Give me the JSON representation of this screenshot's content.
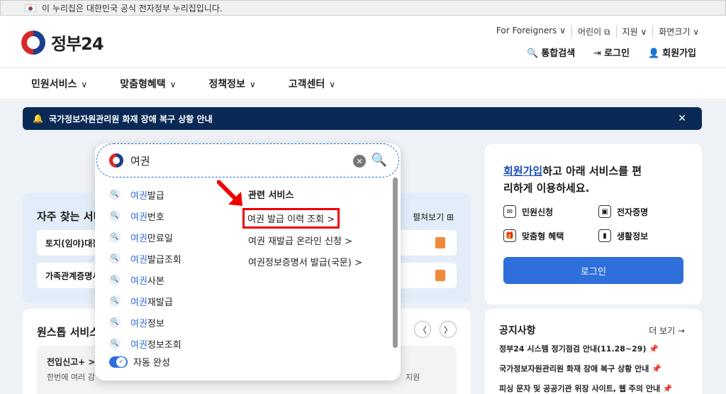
{
  "topbar": {
    "text": "이 누리집은 대한민국 공식 전자정부 누리집입니다."
  },
  "logo": {
    "name": "정부24",
    "plus": "+"
  },
  "util": [
    "For Foreigners ∨",
    "어린이 ⧉",
    "지원 ∨",
    "화면크기 ∨"
  ],
  "actions": [
    {
      "icon": "🔍",
      "label": "통합검색"
    },
    {
      "icon": "⇥",
      "label": "로그인"
    },
    {
      "icon": "👤",
      "label": "회원가입"
    }
  ],
  "nav": [
    "민원서비스",
    "맞춤형혜택",
    "정책정보",
    "고객센터"
  ],
  "notice": {
    "text": "국가정보자원관리원 화재 장애 복구 상황 안내",
    "close": "✕"
  },
  "search": {
    "value": "여권",
    "clear": "✕",
    "suggestions": [
      {
        "hl": "여권",
        "rest": "발급"
      },
      {
        "hl": "여권",
        "rest": "번호"
      },
      {
        "hl": "여권",
        "rest": "만료일"
      },
      {
        "hl": "여권",
        "rest": "발급조회"
      },
      {
        "hl": "여권",
        "rest": "사본"
      },
      {
        "hl": "여권",
        "rest": "재발급"
      },
      {
        "hl": "여권",
        "rest": "정보"
      },
      {
        "hl": "여권",
        "rest": "정보조회"
      }
    ],
    "related_title": "관련 서비스",
    "related": [
      "여권 발급 이력 조회 >",
      "여권 재발급 온라인 신청 >",
      "여권정보증명서 발급(국문) >"
    ],
    "autocomplete_label": "자동 완성"
  },
  "freq": {
    "title": "자주 찾는 서비스",
    "expand": "펼쳐보기 ⊞",
    "items": [
      "토지(임야)대장",
      "가족관계증명서"
    ]
  },
  "onestop": {
    "title": "원스톱 서비스",
    "item_title": "전입신고+ >",
    "item_desc": "한번에 여러 감",
    "item_right": "지원"
  },
  "login_card": {
    "link": "회원가입",
    "msg_rest": "하고 아래 서비스를 편리하게 이용하세요.",
    "services": [
      "민원신청",
      "전자증명",
      "맞춤형 혜택",
      "생활정보"
    ],
    "button": "로그인"
  },
  "noti_card": {
    "title": "공지사항",
    "more": "더 보기 →",
    "items": [
      "정부24 시스템 정기점검 안내(11.28~29) 📌",
      "국가정보자원관리원 화재 장애 복구 상황 안내 📌",
      "피싱 문자 및 공공기관 위장 사이트, 웹 주의 안내 📌"
    ]
  }
}
